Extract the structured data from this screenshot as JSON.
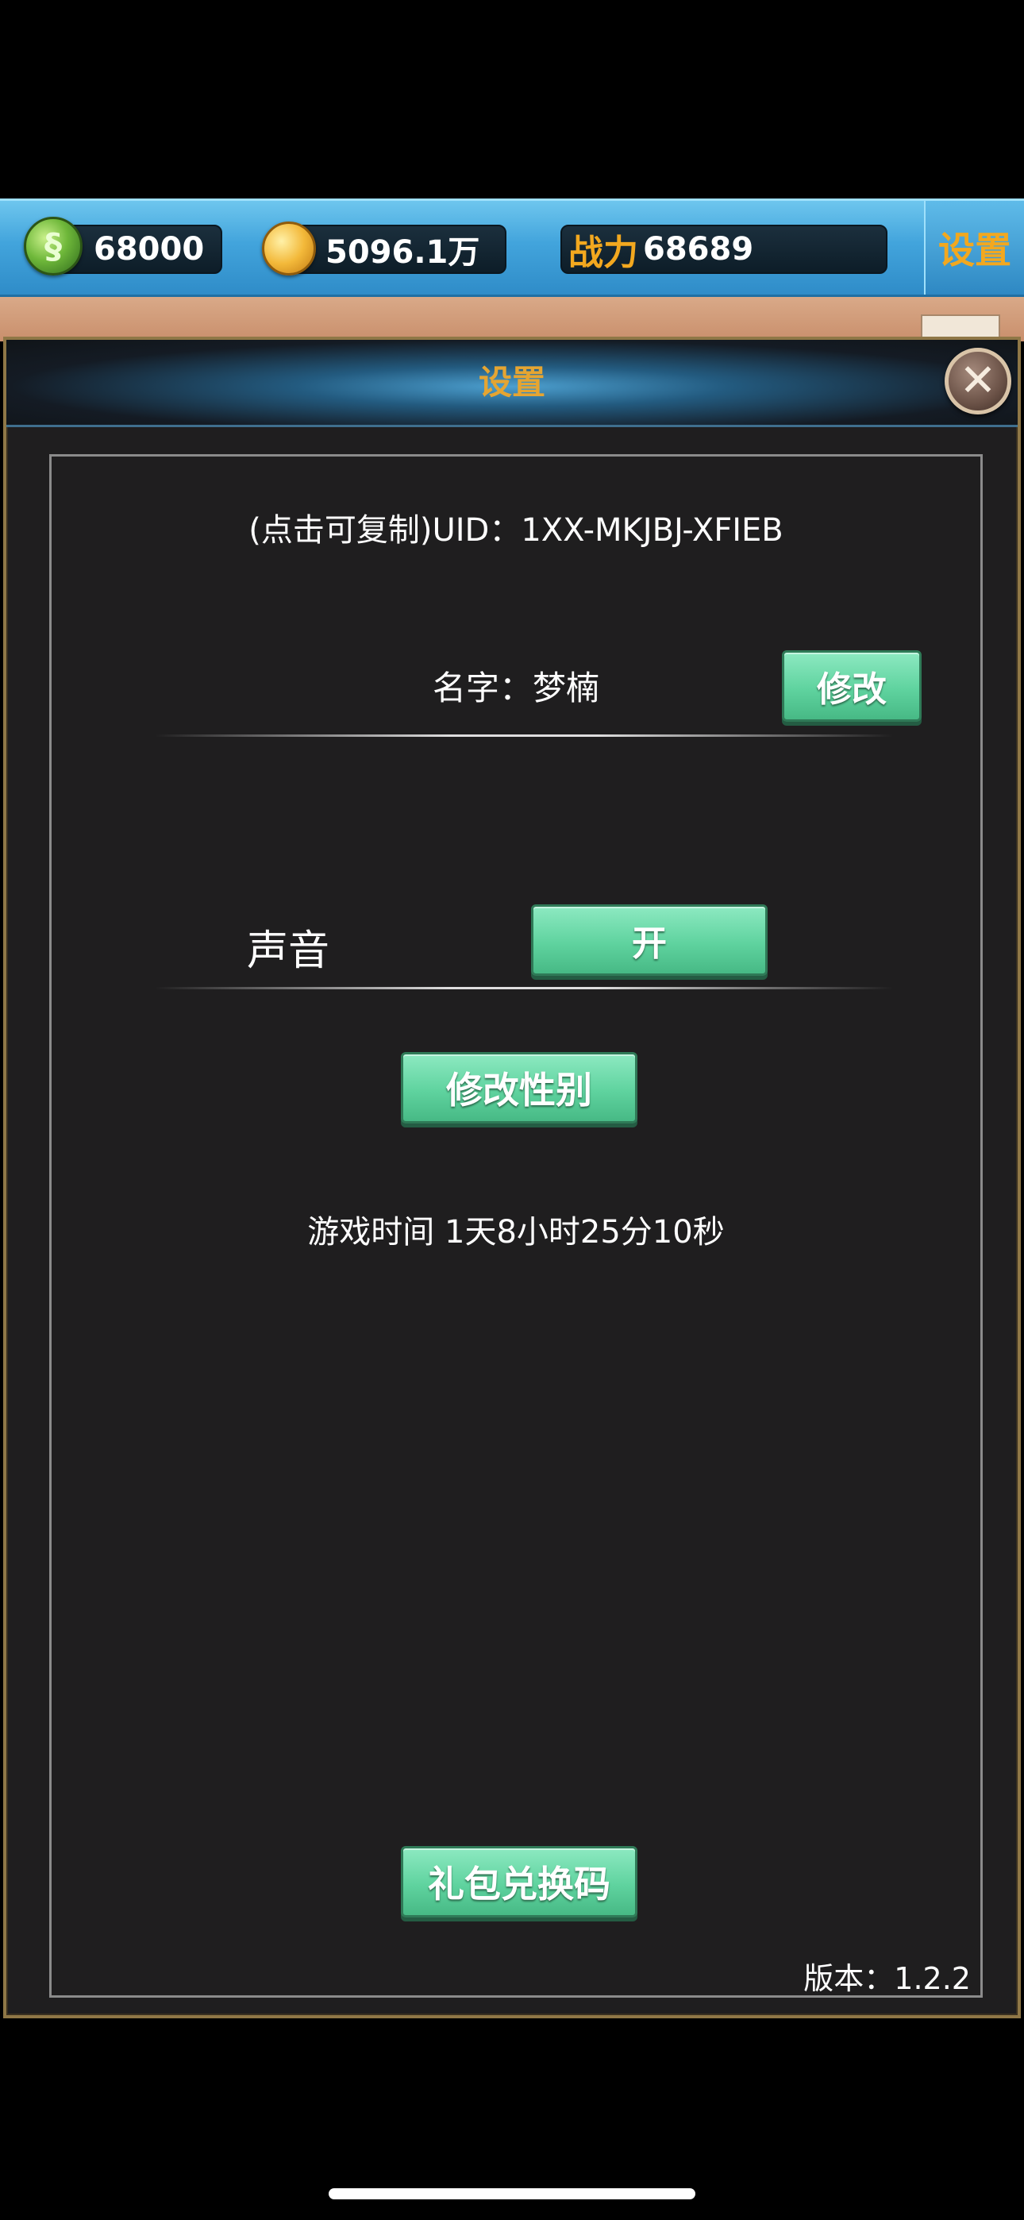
{
  "topbar": {
    "jade": "68000",
    "coins": "5096.1万",
    "power_label": "战力",
    "power_value": "68689",
    "settings_tab": "设置"
  },
  "dialog": {
    "title": "设置",
    "close_icon": "close-x",
    "uid_text": "(点击可复制)UID：1XX-MKJBJ-XFIEB",
    "name_text": "名字：梦楠",
    "edit_button": "修改",
    "sound_label": "声音",
    "sound_button": "开",
    "gender_button": "修改性别",
    "playtime_text": "游戏时间 1天8小时25分10秒",
    "gift_code_button": "礼包兑换码",
    "version_text": "版本：1.2.2"
  },
  "icons": {
    "jade": "jade-icon",
    "coin": "coin-icon"
  },
  "colors": {
    "accent_gold": "#e5a532",
    "button_green": "#5fd39f",
    "topbar_blue": "#42a4dc",
    "dialog_bg": "#1f1e1f"
  }
}
